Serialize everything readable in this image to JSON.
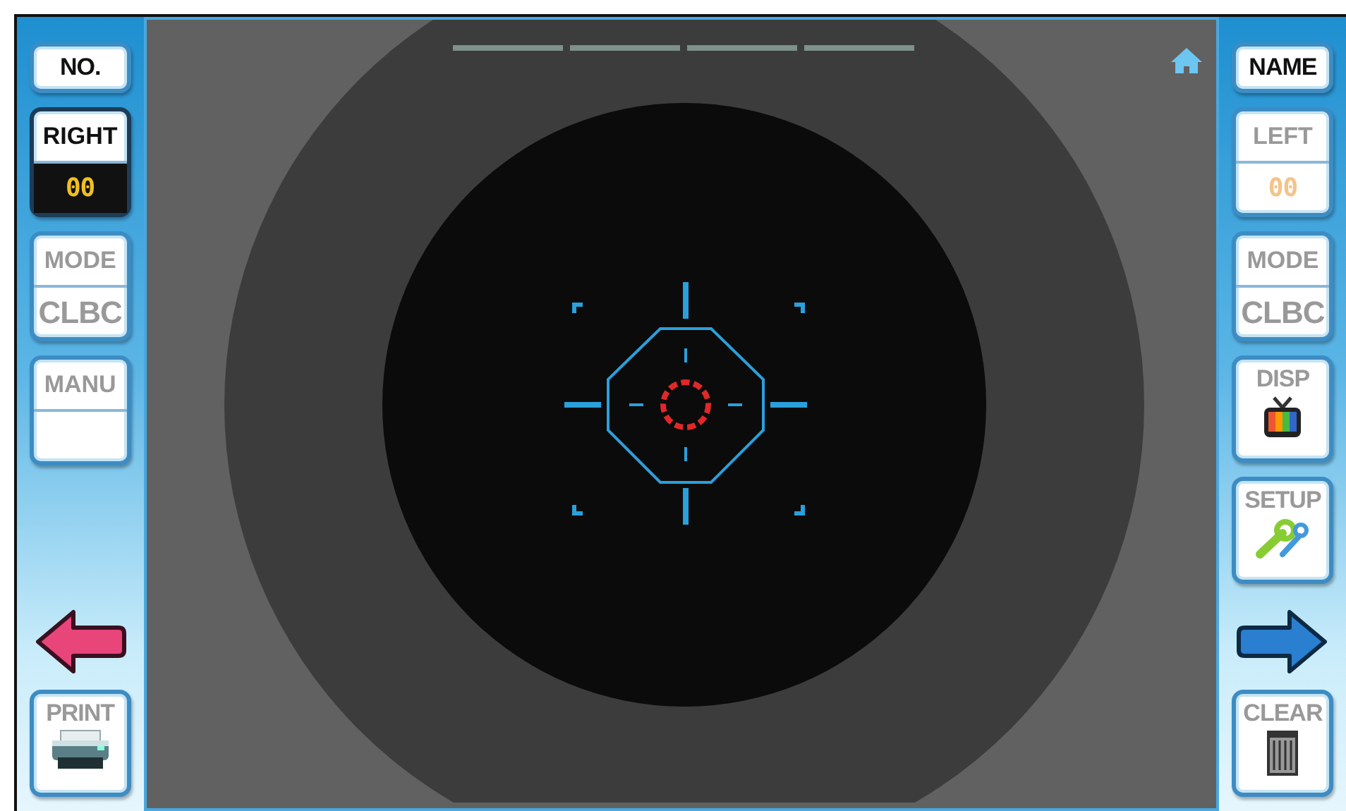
{
  "left_panel": [
    {
      "kind": "plain",
      "label": "NO.",
      "disabled": false
    },
    {
      "kind": "eye",
      "label": "RIGHT",
      "value": "00",
      "selected": true,
      "disabled": false
    },
    {
      "kind": "split",
      "label": "MODE",
      "value": "CLBC",
      "selected": false,
      "disabled": true
    },
    {
      "kind": "split",
      "label": "MANU",
      "selected": false,
      "disabled": true
    },
    {
      "kind": "back"
    },
    {
      "kind": "printer",
      "label": "PRINT",
      "disabled": true
    }
  ],
  "right_panel": [
    {
      "kind": "plain",
      "label": "NAME",
      "disabled": false
    },
    {
      "kind": "eye",
      "label": "LEFT",
      "value": "00",
      "selected": false,
      "disabled": true
    },
    {
      "kind": "split",
      "label": "MODE",
      "value": "CLBC",
      "selected": false,
      "disabled": true
    },
    {
      "kind": "tv",
      "label": "DISP",
      "disabled": true
    },
    {
      "kind": "tools",
      "label": "SETUP",
      "disabled": true
    },
    {
      "kind": "forward"
    },
    {
      "kind": "trash",
      "label": "CLEAR",
      "disabled": true
    }
  ]
}
